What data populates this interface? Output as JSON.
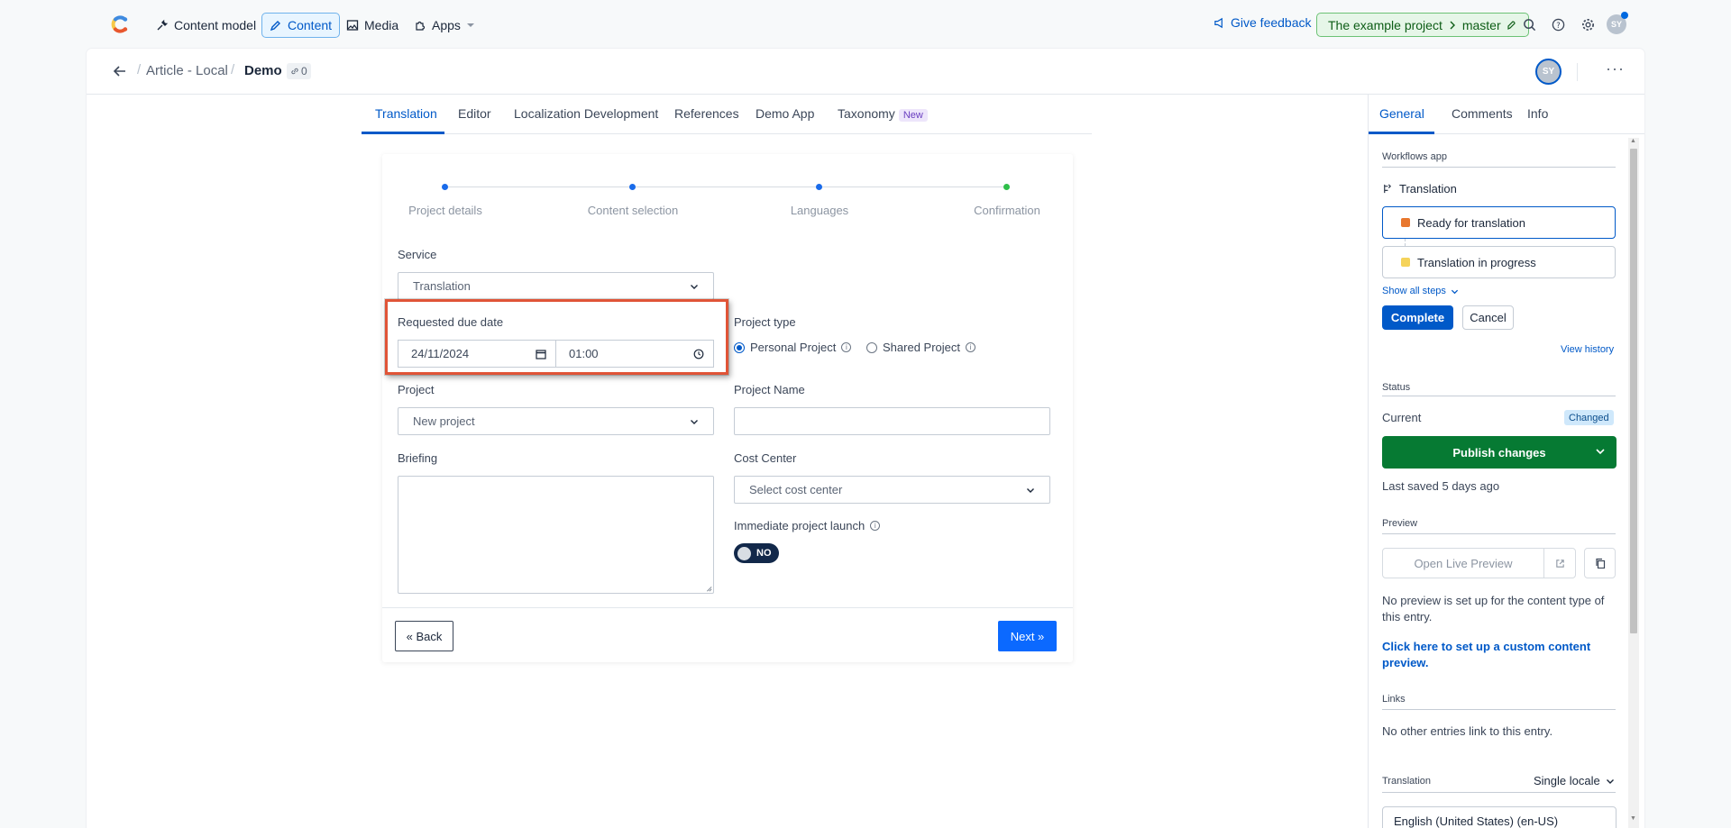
{
  "topbar": {
    "nav": [
      {
        "label": "Content model",
        "icon": "wrench-icon"
      },
      {
        "label": "Content",
        "icon": "pen-icon"
      },
      {
        "label": "Media",
        "icon": "image-icon"
      },
      {
        "label": "Apps",
        "icon": "puzzle-icon"
      }
    ],
    "feedback": "Give feedback",
    "environment": {
      "project": "The example project",
      "branch": "master"
    },
    "avatar_initials": "SY",
    "colors": {
      "accent": "#0059c8",
      "env_bg": "#e6f6e8"
    }
  },
  "entry": {
    "breadcrumbs": [
      "Article - Local",
      "Demo"
    ],
    "link_count": "0",
    "avatar_initials": "SY"
  },
  "tabs": [
    {
      "label": "Translation"
    },
    {
      "label": "Editor"
    },
    {
      "label": "Localization Development"
    },
    {
      "label": "References"
    },
    {
      "label": "Demo App"
    },
    {
      "label": "Taxonomy",
      "badge": "New"
    }
  ],
  "wizard": {
    "steps": [
      "Project details",
      "Content selection",
      "Languages",
      "Confirmation"
    ],
    "step_colors": [
      "#1a6bea",
      "#1a6bea",
      "#1a6bea",
      "#2fbf4a"
    ],
    "service": {
      "label": "Service",
      "value": "Translation"
    },
    "due_date": {
      "label": "Requested due date",
      "date": "24/11/2024",
      "time": "01:00"
    },
    "project_type": {
      "label": "Project type",
      "options": [
        "Personal Project",
        "Shared Project"
      ],
      "selected": "Personal Project"
    },
    "project": {
      "label": "Project",
      "value": "New project"
    },
    "project_name": {
      "label": "Project Name",
      "value": ""
    },
    "briefing": {
      "label": "Briefing"
    },
    "cost_center": {
      "label": "Cost Center",
      "value": "Select cost center"
    },
    "immediate_launch": {
      "label": "Immediate project launch",
      "state": "NO"
    },
    "back_label": "« Back",
    "next_label": "Next »"
  },
  "sidebar": {
    "tabs": [
      "General",
      "Comments",
      "Info"
    ],
    "workflows_title": "Workflows app",
    "workflow_name": "Translation",
    "workflow_steps": [
      {
        "label": "Ready for translation",
        "color": "#e8772e"
      },
      {
        "label": "Translation in progress",
        "color": "#f5d35a"
      }
    ],
    "show_all_steps": "Show all steps",
    "complete_label": "Complete",
    "cancel_label": "Cancel",
    "view_history": "View history",
    "status_title": "Status",
    "status_current": "Current",
    "status_badge": "Changed",
    "publish_label": "Publish changes",
    "last_saved": "Last saved 5 days ago",
    "preview_title": "Preview",
    "open_live_preview": "Open Live Preview",
    "preview_note": "No preview is set up for the content type of this entry.",
    "preview_setup_link": "Click here to set up a custom content preview.",
    "links_title": "Links",
    "links_note": "No other entries link to this entry.",
    "translation_title": "Translation",
    "translation_mode": "Single locale",
    "locale_value": "English (United States) (en-US)"
  }
}
